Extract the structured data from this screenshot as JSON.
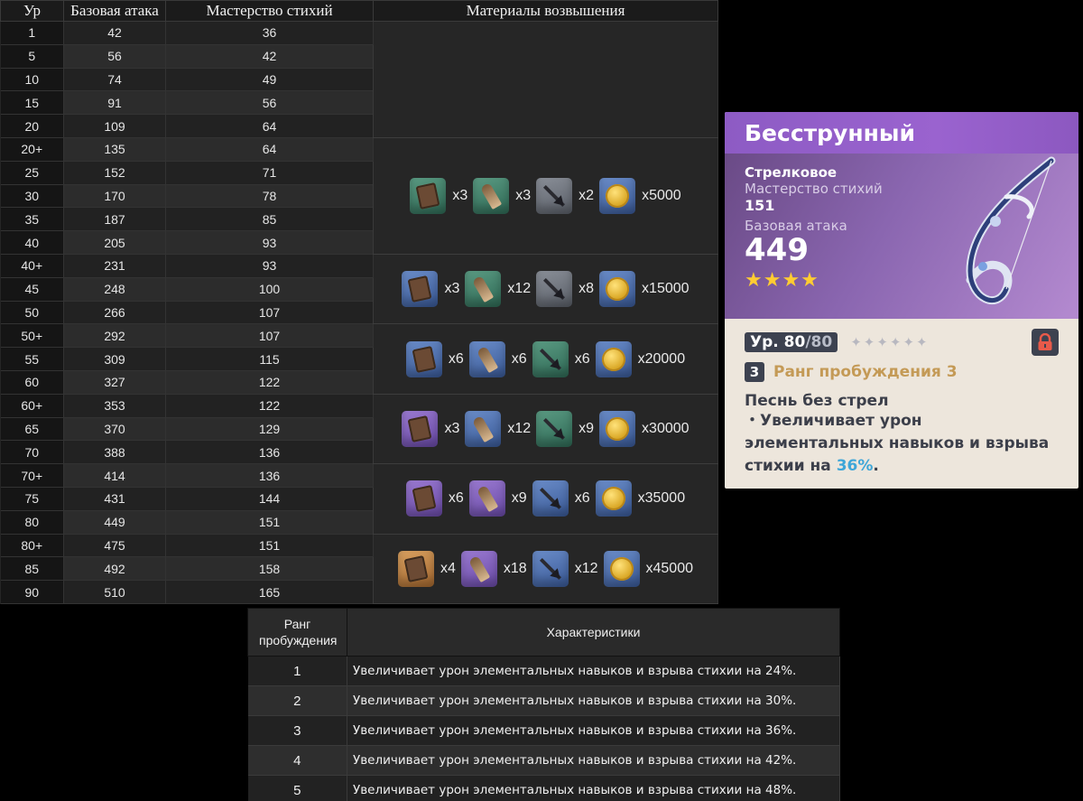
{
  "stats": {
    "headers": {
      "level": "Ур",
      "base_atk": "Базовая атака",
      "em": "Мастерство стихий",
      "materials": "Материалы возвышения"
    },
    "rows": [
      {
        "lv": "1",
        "atk": "42",
        "em": "36"
      },
      {
        "lv": "5",
        "atk": "56",
        "em": "42"
      },
      {
        "lv": "10",
        "atk": "74",
        "em": "49"
      },
      {
        "lv": "15",
        "atk": "91",
        "em": "56"
      },
      {
        "lv": "20",
        "atk": "109",
        "em": "64"
      },
      {
        "lv": "20+",
        "atk": "135",
        "em": "64"
      },
      {
        "lv": "25",
        "atk": "152",
        "em": "71"
      },
      {
        "lv": "30",
        "atk": "170",
        "em": "78"
      },
      {
        "lv": "35",
        "atk": "187",
        "em": "85"
      },
      {
        "lv": "40",
        "atk": "205",
        "em": "93"
      },
      {
        "lv": "40+",
        "atk": "231",
        "em": "93"
      },
      {
        "lv": "45",
        "atk": "248",
        "em": "100"
      },
      {
        "lv": "50",
        "atk": "266",
        "em": "107"
      },
      {
        "lv": "50+",
        "atk": "292",
        "em": "107"
      },
      {
        "lv": "55",
        "atk": "309",
        "em": "115"
      },
      {
        "lv": "60",
        "atk": "327",
        "em": "122"
      },
      {
        "lv": "60+",
        "atk": "353",
        "em": "122"
      },
      {
        "lv": "65",
        "atk": "370",
        "em": "129"
      },
      {
        "lv": "70",
        "atk": "388",
        "em": "136"
      },
      {
        "lv": "70+",
        "atk": "414",
        "em": "136"
      },
      {
        "lv": "75",
        "atk": "431",
        "em": "144"
      },
      {
        "lv": "80",
        "atk": "449",
        "em": "151"
      },
      {
        "lv": "80+",
        "atk": "475",
        "em": "151"
      },
      {
        "lv": "85",
        "atk": "492",
        "em": "158"
      },
      {
        "lv": "90",
        "atk": "510",
        "em": "165"
      }
    ],
    "materials": [
      {
        "start": 5,
        "span": 5,
        "items": [
          {
            "icon": "scroll-icon",
            "q": "q2",
            "qty": "x3"
          },
          {
            "icon": "horn-icon",
            "q": "q2",
            "qty": "x3"
          },
          {
            "icon": "arrowhead-icon",
            "q": "qg",
            "qty": "x2"
          },
          {
            "icon": "mora-coin-icon",
            "q": "q3",
            "qty": "x5000"
          }
        ]
      },
      {
        "start": 10,
        "span": 3,
        "items": [
          {
            "icon": "scroll-icon",
            "q": "q3",
            "qty": "x3"
          },
          {
            "icon": "horn-icon",
            "q": "q2",
            "qty": "x12"
          },
          {
            "icon": "arrowhead-icon",
            "q": "qg",
            "qty": "x8"
          },
          {
            "icon": "mora-coin-icon",
            "q": "q3",
            "qty": "x15000"
          }
        ]
      },
      {
        "start": 13,
        "span": 3,
        "items": [
          {
            "icon": "scroll-icon",
            "q": "q3",
            "qty": "x6"
          },
          {
            "icon": "horn-icon",
            "q": "q3",
            "qty": "x6"
          },
          {
            "icon": "arrowhead-icon",
            "q": "q2",
            "qty": "x6"
          },
          {
            "icon": "mora-coin-icon",
            "q": "q3",
            "qty": "x20000"
          }
        ]
      },
      {
        "start": 16,
        "span": 3,
        "items": [
          {
            "icon": "scroll-icon",
            "q": "q4",
            "qty": "x3"
          },
          {
            "icon": "horn-icon",
            "q": "q3",
            "qty": "x12"
          },
          {
            "icon": "arrowhead-icon",
            "q": "q2",
            "qty": "x9"
          },
          {
            "icon": "mora-coin-icon",
            "q": "q3",
            "qty": "x30000"
          }
        ]
      },
      {
        "start": 19,
        "span": 3,
        "items": [
          {
            "icon": "scroll-icon",
            "q": "q4",
            "qty": "x6"
          },
          {
            "icon": "horn-icon",
            "q": "q4",
            "qty": "x9"
          },
          {
            "icon": "arrowhead-icon",
            "q": "q3",
            "qty": "x6"
          },
          {
            "icon": "mora-coin-icon",
            "q": "q3",
            "qty": "x35000"
          }
        ]
      },
      {
        "start": 22,
        "span": 3,
        "items": [
          {
            "icon": "scroll-icon",
            "q": "q5",
            "qty": "x4"
          },
          {
            "icon": "horn-icon",
            "q": "q4",
            "qty": "x18"
          },
          {
            "icon": "arrowhead-icon",
            "q": "q3",
            "qty": "x12"
          },
          {
            "icon": "mora-coin-icon",
            "q": "q3",
            "qty": "x45000"
          }
        ]
      }
    ]
  },
  "card": {
    "name": "Бесструнный",
    "type": "Стрелковое",
    "substat_label": "Мастерство стихий",
    "substat_value": "151",
    "atk_label": "Базовая атака",
    "atk_value": "449",
    "rarity_stars": "★★★★",
    "level": "Ур. 80",
    "level_max": "/80",
    "ascension_stars": "✦✦✦✦✦✦",
    "rank_num": "3",
    "rank_text": "Ранг пробуждения 3",
    "passive_name": "Песнь без стрел",
    "passive_desc_pre": "・Увеличивает урон элементальных навыков и взрыва стихии на ",
    "passive_desc_value": "36%",
    "passive_desc_post": ".",
    "colors": {
      "header": "#9a63cf",
      "highlight": "#3ea6d8",
      "rank": "#c49a56",
      "stars": "#ffcc32"
    }
  },
  "refinement": {
    "headers": {
      "rank": "Ранг пробуждения",
      "desc": "Характеристики"
    },
    "rows": [
      {
        "rank": "1",
        "desc": "Увеличивает урон элементальных навыков и взрыва стихии на 24%."
      },
      {
        "rank": "2",
        "desc": "Увеличивает урон элементальных навыков и взрыва стихии на 30%."
      },
      {
        "rank": "3",
        "desc": "Увеличивает урон элементальных навыков и взрыва стихии на 36%."
      },
      {
        "rank": "4",
        "desc": "Увеличивает урон элементальных навыков и взрыва стихии на 42%."
      },
      {
        "rank": "5",
        "desc": "Увеличивает урон элементальных навыков и взрыва стихии на 48%."
      }
    ]
  }
}
